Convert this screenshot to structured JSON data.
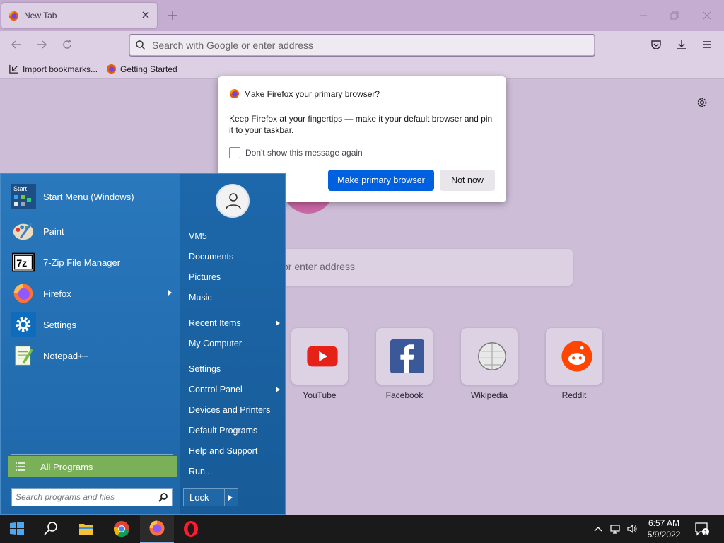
{
  "browser": {
    "tab_title": "New Tab",
    "url_placeholder": "Search with Google or enter address",
    "bookmarks": [
      "Import bookmarks...",
      "Getting Started"
    ]
  },
  "newtab": {
    "search_placeholder_visible": "or enter address",
    "top_sites": [
      {
        "label": "YouTube",
        "icon": "youtube-icon"
      },
      {
        "label": "Facebook",
        "icon": "facebook-icon"
      },
      {
        "label": "Wikipedia",
        "icon": "wikipedia-icon"
      },
      {
        "label": "Reddit",
        "icon": "reddit-icon"
      }
    ]
  },
  "notification": {
    "title": "Make Firefox your primary browser?",
    "body": "Keep Firefox at your fingertips — make it your default browser and pin it to your taskbar.",
    "checkbox_label": "Don't show this message again",
    "checkbox_checked": false,
    "primary_button": "Make primary browser",
    "secondary_button": "Not now"
  },
  "start_menu": {
    "programs": [
      {
        "label": "Start Menu (Windows)",
        "icon": "start-menu-icon",
        "submenu": false
      },
      {
        "label": "Paint",
        "icon": "paint-icon",
        "submenu": false
      },
      {
        "label": "7-Zip File Manager",
        "icon": "7zip-icon",
        "submenu": false
      },
      {
        "label": "Firefox",
        "icon": "firefox-icon",
        "submenu": true
      },
      {
        "label": "Settings",
        "icon": "settings-gear-icon",
        "submenu": false
      },
      {
        "label": "Notepad++",
        "icon": "notepadpp-icon",
        "submenu": false
      }
    ],
    "all_programs": "All Programs",
    "search_placeholder": "Search programs and files",
    "right_items": [
      {
        "label": "VM5",
        "submenu": false
      },
      {
        "label": "Documents",
        "submenu": false
      },
      {
        "label": "Pictures",
        "submenu": false
      },
      {
        "label": "Music",
        "submenu": false
      },
      {
        "label": "Recent Items",
        "submenu": true
      },
      {
        "label": "My Computer",
        "submenu": false
      },
      {
        "label": "Settings",
        "submenu": false
      },
      {
        "label": "Control Panel",
        "submenu": true
      },
      {
        "label": "Devices and Printers",
        "submenu": false
      },
      {
        "label": "Default Programs",
        "submenu": false
      },
      {
        "label": "Help and Support",
        "submenu": false
      },
      {
        "label": "Run...",
        "submenu": false
      }
    ],
    "lock_label": "Lock",
    "start_icon_text": "Start"
  },
  "taskbar": {
    "time": "6:57 AM",
    "date": "5/9/2022",
    "notification_count": "1"
  },
  "colors": {
    "accent_blue": "#0061e0",
    "start_menu_blue": "#1d67a8",
    "all_programs_green": "#79b058",
    "firefox_theme": "#ddd0e4"
  }
}
